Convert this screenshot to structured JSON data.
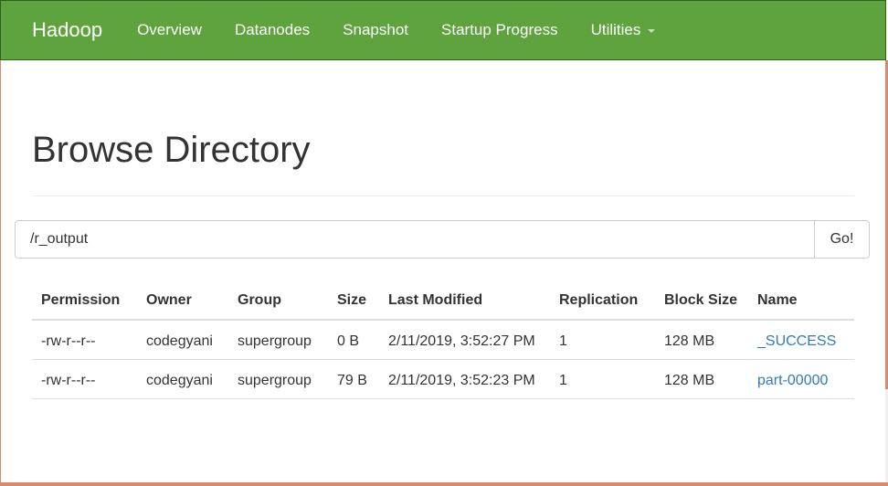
{
  "navbar": {
    "brand": "Hadoop",
    "items": [
      {
        "label": "Overview"
      },
      {
        "label": "Datanodes"
      },
      {
        "label": "Snapshot"
      },
      {
        "label": "Startup Progress"
      },
      {
        "label": "Utilities"
      }
    ]
  },
  "page": {
    "title": "Browse Directory"
  },
  "search": {
    "value": "/r_output",
    "go_label": "Go!"
  },
  "table": {
    "headers": {
      "permission": "Permission",
      "owner": "Owner",
      "group": "Group",
      "size": "Size",
      "last_modified": "Last Modified",
      "replication": "Replication",
      "block_size": "Block Size",
      "name": "Name"
    },
    "rows": [
      {
        "permission": "-rw-r--r--",
        "owner": "codegyani",
        "group": "supergroup",
        "size": "0 B",
        "last_modified": "2/11/2019, 3:52:27 PM",
        "replication": "1",
        "block_size": "128 MB",
        "name": "_SUCCESS"
      },
      {
        "permission": "-rw-r--r--",
        "owner": "codegyani",
        "group": "supergroup",
        "size": "79 B",
        "last_modified": "2/11/2019, 3:52:23 PM",
        "replication": "1",
        "block_size": "128 MB",
        "name": "part-00000"
      }
    ]
  },
  "colors": {
    "navbar": "#5fa33e",
    "link": "#337ab7"
  }
}
